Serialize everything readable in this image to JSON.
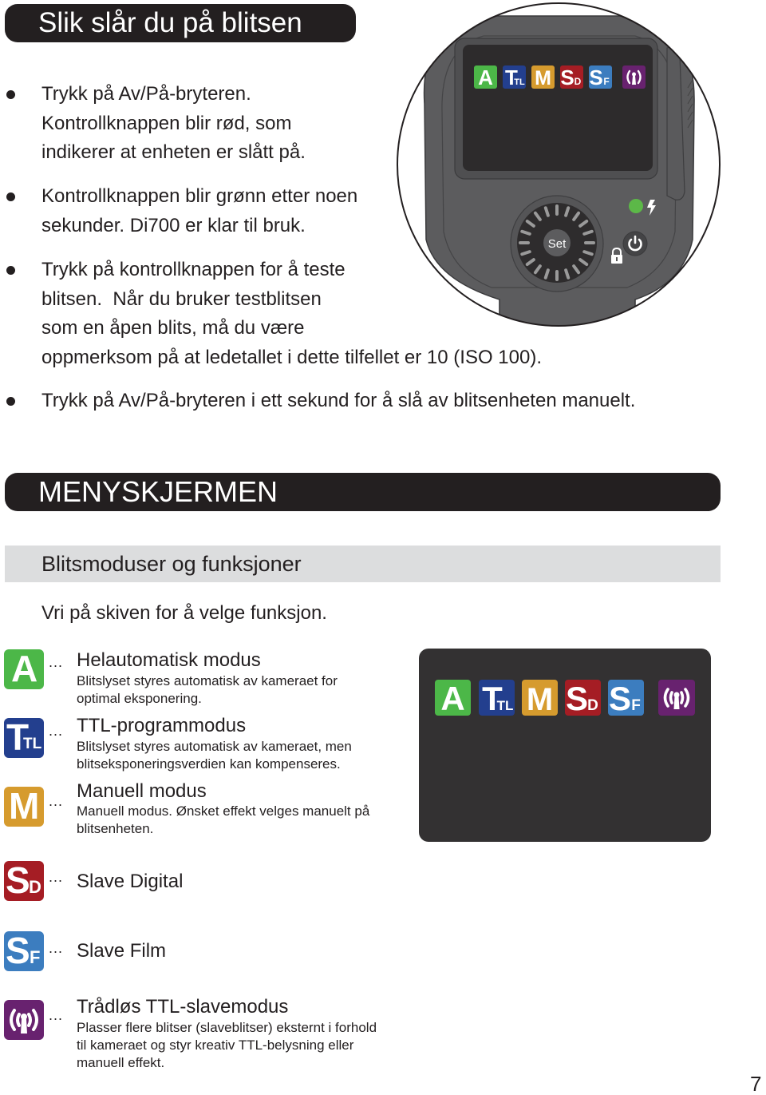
{
  "section1": {
    "title": "Slik slår du på blitsen",
    "bullets": [
      {
        "lines": "Trykk på Av/På-bryteren.\nKontrollknappen blir rød, som\nindikerer at enheten er slått på."
      },
      {
        "lines": "Kontrollknappen blir grønn etter noen\nsekunder. Di700 er klar til bruk."
      },
      {
        "lines": "Trykk på kontrollknappen for å teste\nblitsen.  Når du bruker testblitsen\nsom en åpen blits, må du være\noppmerksom på at ledetallet i dette tilfellet er 10 (ISO 100)."
      },
      {
        "lines": "Trykk på Av/På-bryteren i ett sekund for å slå av blitsenheten manuelt."
      }
    ]
  },
  "device": {
    "dial_label": "Set",
    "status_led_color": "#5cb848",
    "icons": [
      "mode-a",
      "mode-ttl",
      "mode-m",
      "mode-sd",
      "mode-sf",
      "mode-wireless",
      "ready-led",
      "flash-bolt",
      "power-button",
      "lock"
    ]
  },
  "section2": {
    "title": "MENYSKJERMEN",
    "subtitle": "Blitsmoduser og funksjoner",
    "instruction": "Vri på skiven for å velge funksjon.",
    "ellipsis": "...",
    "modes": [
      {
        "key": "A",
        "badge": "A",
        "color": "#4cb748",
        "title": "Helautomatisk modus",
        "description": "Blitslyset styres automatisk av kameraet for\noptimal eksponering."
      },
      {
        "key": "TTL",
        "badge_main": "T",
        "badge_sub": "TL",
        "color": "#233f8e",
        "title": "TTL-programmodus",
        "description": "Blitslyset styres automatisk av kameraet, men\nblitseksponeringsverdien kan kompenseres."
      },
      {
        "key": "M",
        "badge": "M",
        "color": "#d69b2e",
        "title": "Manuell modus",
        "description": "Manuell modus. Ønsket effekt velges manuelt på\nblitsenheten."
      },
      {
        "key": "SD",
        "badge_main": "S",
        "badge_sub": "D",
        "color": "#a51d24",
        "title": "Slave Digital",
        "description": ""
      },
      {
        "key": "SF",
        "badge_main": "S",
        "badge_sub": "F",
        "color": "#3c7dbf",
        "title": "Slave Film",
        "description": ""
      },
      {
        "key": "WL",
        "color": "#68226f",
        "title": "Trådløs TTL-slavemodus",
        "description": "Plasser flere blitser (slaveblitser) eksternt i forhold\ntil kameraet og styr kreativ TTL-belysning eller\nmanuell effekt."
      }
    ]
  },
  "page_number": "7"
}
